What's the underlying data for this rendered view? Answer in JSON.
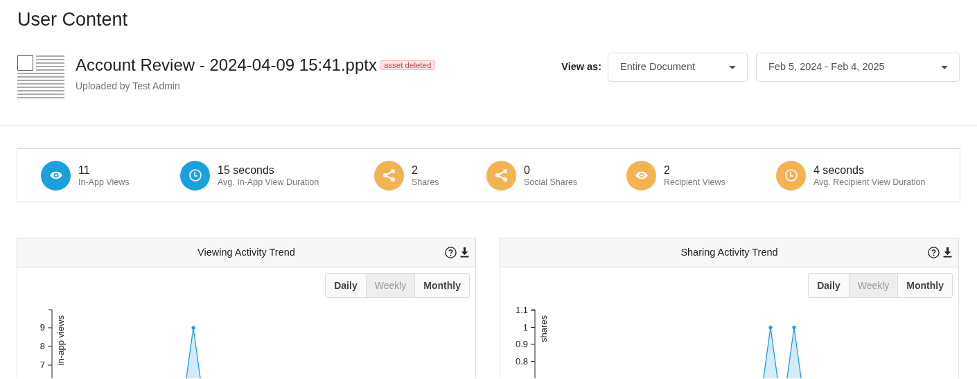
{
  "page_title": "User Content",
  "document": {
    "title": "Account Review - 2024-04-09 15:41.pptx",
    "badge": "asset deleted",
    "subtitle": "Uploaded by Test Admin"
  },
  "view_as": {
    "label": "View as:",
    "scope": "Entire Document",
    "date_range": "Feb 5, 2024 - Feb 4, 2025"
  },
  "stats": [
    {
      "kind": "views",
      "color": "#1aa0dd",
      "value": "11",
      "label": "In-App Views"
    },
    {
      "kind": "duration",
      "color": "#1aa0dd",
      "value": "15 seconds",
      "label": "Avg. In-App View Duration"
    },
    {
      "kind": "shares",
      "color": "#f4b350",
      "value": "2",
      "label": "Shares"
    },
    {
      "kind": "shares",
      "color": "#f4b350",
      "value": "0",
      "label": "Social Shares"
    },
    {
      "kind": "views",
      "color": "#f4b350",
      "value": "2",
      "label": "Recipient Views"
    },
    {
      "kind": "duration",
      "color": "#f4b350",
      "value": "4 seconds",
      "label": "Avg. Recipient View Duration"
    }
  ],
  "panels": [
    {
      "title": "Viewing Activity Trend",
      "periods": [
        {
          "label": "Daily",
          "selected": false
        },
        {
          "label": "Weekly",
          "selected": true
        },
        {
          "label": "Monthly",
          "selected": false
        }
      ],
      "axis_title": "in-app views",
      "tick_labels": [
        "9",
        "8",
        "7"
      ]
    },
    {
      "title": "Sharing Activity Trend",
      "periods": [
        {
          "label": "Daily",
          "selected": false
        },
        {
          "label": "Weekly",
          "selected": true
        },
        {
          "label": "Monthly",
          "selected": false
        }
      ],
      "axis_title": "shares",
      "tick_labels": [
        "1.1",
        "1",
        "0.9",
        "0.8"
      ]
    }
  ]
}
